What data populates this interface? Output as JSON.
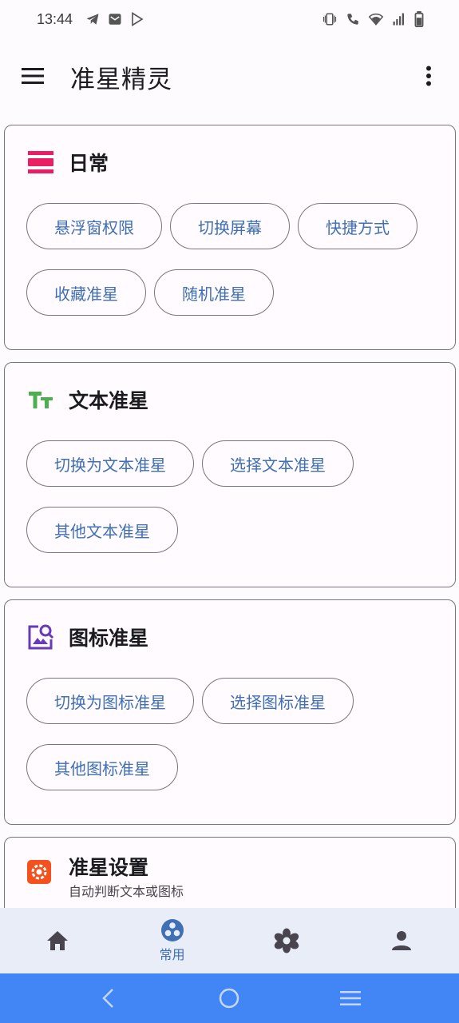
{
  "status_bar": {
    "time": "13:44",
    "left_icons": [
      "telegram-icon",
      "mail-icon",
      "play-store-icon"
    ],
    "right_icons": [
      "vibrate-icon",
      "wifi-call-icon",
      "wifi-icon",
      "signal-icon",
      "battery-icon"
    ]
  },
  "app_bar": {
    "title": "准星精灵",
    "menu_icon": "hamburger-menu-icon",
    "more_icon": "more-vert-icon"
  },
  "sections": [
    {
      "title": "日常",
      "icon": "daily-icon",
      "icon_color": "#e91e63",
      "chips": [
        [
          "悬浮窗权限",
          "切换屏幕",
          "快捷方式"
        ],
        [
          "收藏准星",
          "随机准星"
        ]
      ]
    },
    {
      "title": "文本准星",
      "icon": "text-size-icon",
      "icon_color": "#4caf50",
      "chips": [
        [
          "切换为文本准星",
          "选择文本准星"
        ],
        [
          "其他文本准星"
        ]
      ]
    },
    {
      "title": "图标准星",
      "icon": "image-search-icon",
      "icon_color": "#673ab7",
      "chips": [
        [
          "切换为图标准星",
          "选择图标准星"
        ],
        [
          "其他图标准星"
        ]
      ]
    }
  ],
  "settings_card": {
    "title": "准星设置",
    "subtitle": "自动判断文本或图标",
    "icon": "settings-gear-icon",
    "icon_color": "#f4511e"
  },
  "bottom_nav": {
    "items": [
      {
        "icon": "home-icon",
        "label": ""
      },
      {
        "icon": "bubbles-icon",
        "label": "常用",
        "selected": true
      },
      {
        "icon": "flower-icon",
        "label": ""
      },
      {
        "icon": "person-icon",
        "label": ""
      }
    ]
  },
  "colors": {
    "accent": "#3f6fb5",
    "nav_background": "#e8edf8",
    "system_nav": "#4285f4"
  }
}
